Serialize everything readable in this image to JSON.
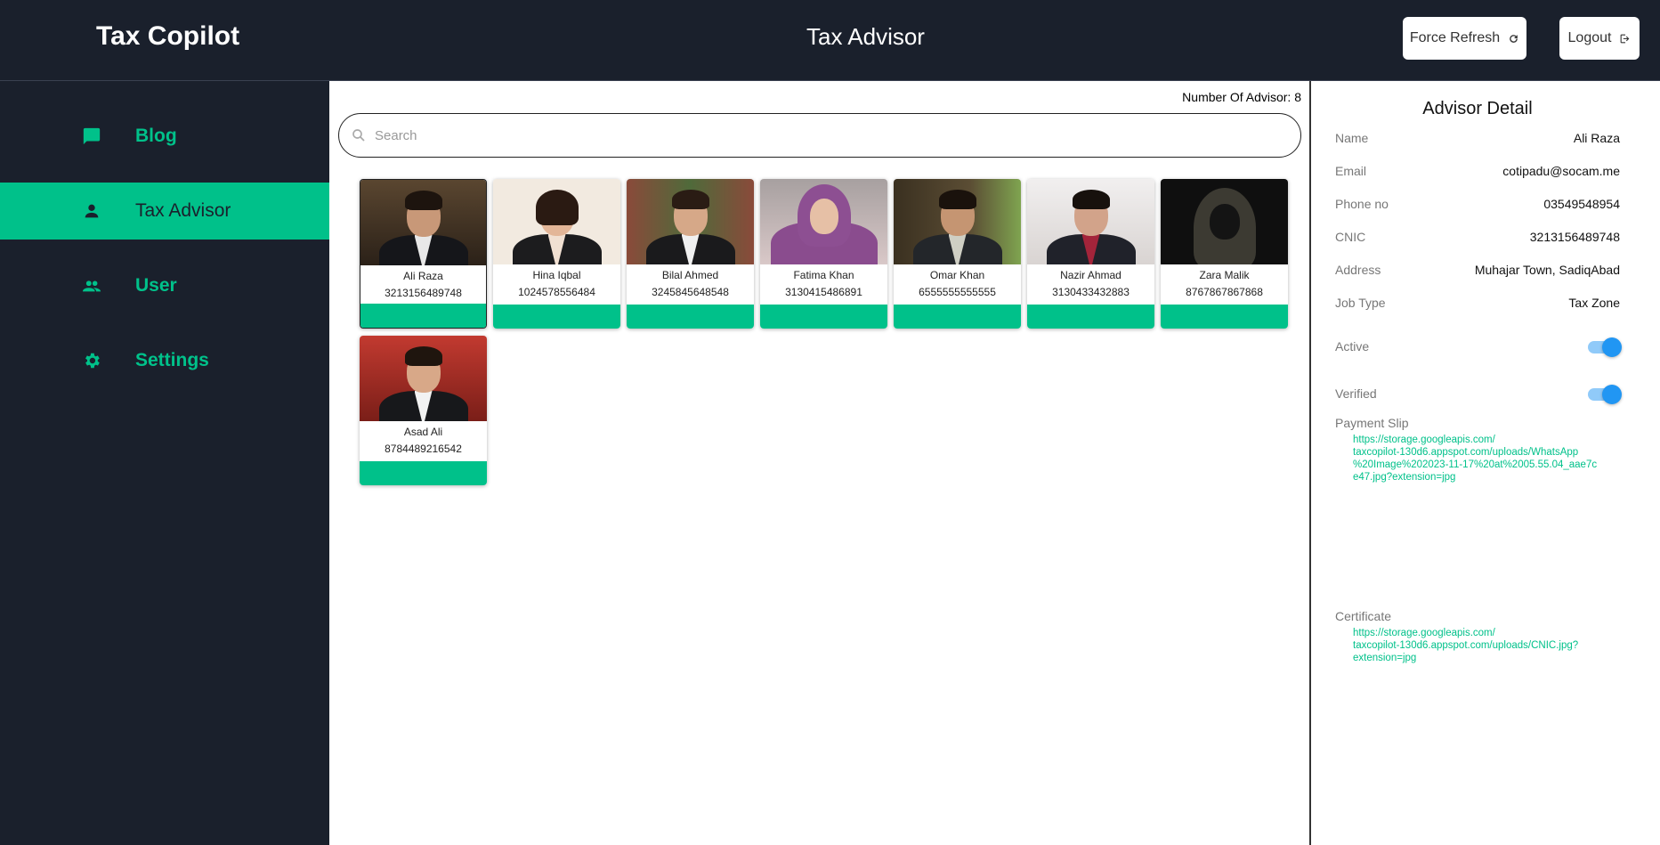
{
  "app": {
    "brand": "Tax Copilot",
    "page_title": "Tax Advisor"
  },
  "header": {
    "refresh_label": "Force Refresh",
    "logout_label": "Logout"
  },
  "sidebar": {
    "items": [
      {
        "label": "Blog",
        "icon": "chat-icon",
        "active": false
      },
      {
        "label": "Tax Advisor",
        "icon": "person-icon",
        "active": true
      },
      {
        "label": "User",
        "icon": "people-icon",
        "active": false
      },
      {
        "label": "Settings",
        "icon": "gear-icon",
        "active": false
      }
    ]
  },
  "main": {
    "count_label": "Number Of Advisor: 8",
    "search_placeholder": "Search",
    "advisors": [
      {
        "name": "Ali Raza",
        "phone": "3213156489748",
        "selected": true
      },
      {
        "name": "Hina Iqbal",
        "phone": "1024578556484",
        "selected": false
      },
      {
        "name": "Bilal Ahmed",
        "phone": "3245845648548",
        "selected": false
      },
      {
        "name": "Fatima Khan",
        "phone": "3130415486891",
        "selected": false
      },
      {
        "name": "Omar Khan",
        "phone": "6555555555555",
        "selected": false
      },
      {
        "name": "Nazir Ahmad",
        "phone": "3130433432883",
        "selected": false
      },
      {
        "name": "Zara Malik",
        "phone": "8767867867868",
        "selected": false
      },
      {
        "name": "Asad Ali",
        "phone": "8784489216542",
        "selected": false
      }
    ]
  },
  "detail": {
    "title": "Advisor Detail",
    "fields": [
      {
        "key": "Name",
        "value": "Ali Raza"
      },
      {
        "key": "Email",
        "value": "cotipadu@socam.me"
      },
      {
        "key": "Phone no",
        "value": "03549548954"
      },
      {
        "key": "CNIC",
        "value": "3213156489748"
      },
      {
        "key": "Address",
        "value": "Muhajar Town, SadiqAbad"
      },
      {
        "key": "Job Type",
        "value": "Tax Zone"
      }
    ],
    "active_label": "Active",
    "active_on": true,
    "verified_label": "Verified",
    "verified_on": true,
    "payment_label": "Payment Slip",
    "payment_link": [
      "https://storage.googleapis.com/",
      "taxcopilot-130d6.appspot.com/uploads/WhatsApp",
      "%20Image%202023-11-17%20at%2005.55.04_aae7c",
      "e47.jpg?extension=jpg"
    ],
    "certificate_label": "Certificate",
    "certificate_link": [
      "https://storage.googleapis.com/",
      "taxcopilot-130d6.appspot.com/uploads/CNIC.jpg?",
      "extension=jpg"
    ]
  },
  "colors": {
    "accent": "#00c18a",
    "sidebar_bg": "#1a202c",
    "toggle": "#2196f3"
  }
}
